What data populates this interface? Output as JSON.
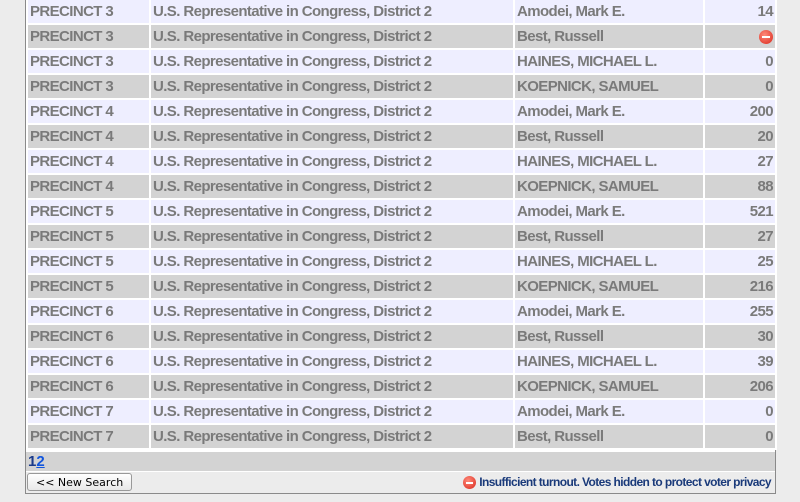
{
  "rows": [
    {
      "precinct": "PRECINCT 3",
      "contest": "U.S. Representative in Congress, District 2",
      "candidate": "Amodei, Mark E.",
      "votes": "14"
    },
    {
      "precinct": "PRECINCT 3",
      "contest": "U.S. Representative in Congress, District 2",
      "candidate": "Best, Russell",
      "votes": null,
      "hidden": true
    },
    {
      "precinct": "PRECINCT 3",
      "contest": "U.S. Representative in Congress, District 2",
      "candidate": "HAINES, MICHAEL L.",
      "votes": "0"
    },
    {
      "precinct": "PRECINCT 3",
      "contest": "U.S. Representative in Congress, District 2",
      "candidate": "KOEPNICK, SAMUEL",
      "votes": "0"
    },
    {
      "precinct": "PRECINCT 4",
      "contest": "U.S. Representative in Congress, District 2",
      "candidate": "Amodei, Mark E.",
      "votes": "200"
    },
    {
      "precinct": "PRECINCT 4",
      "contest": "U.S. Representative in Congress, District 2",
      "candidate": "Best, Russell",
      "votes": "20"
    },
    {
      "precinct": "PRECINCT 4",
      "contest": "U.S. Representative in Congress, District 2",
      "candidate": "HAINES, MICHAEL L.",
      "votes": "27"
    },
    {
      "precinct": "PRECINCT 4",
      "contest": "U.S. Representative in Congress, District 2",
      "candidate": "KOEPNICK, SAMUEL",
      "votes": "88"
    },
    {
      "precinct": "PRECINCT 5",
      "contest": "U.S. Representative in Congress, District 2",
      "candidate": "Amodei, Mark E.",
      "votes": "521"
    },
    {
      "precinct": "PRECINCT 5",
      "contest": "U.S. Representative in Congress, District 2",
      "candidate": "Best, Russell",
      "votes": "27"
    },
    {
      "precinct": "PRECINCT 5",
      "contest": "U.S. Representative in Congress, District 2",
      "candidate": "HAINES, MICHAEL L.",
      "votes": "25"
    },
    {
      "precinct": "PRECINCT 5",
      "contest": "U.S. Representative in Congress, District 2",
      "candidate": "KOEPNICK, SAMUEL",
      "votes": "216"
    },
    {
      "precinct": "PRECINCT 6",
      "contest": "U.S. Representative in Congress, District 2",
      "candidate": "Amodei, Mark E.",
      "votes": "255"
    },
    {
      "precinct": "PRECINCT 6",
      "contest": "U.S. Representative in Congress, District 2",
      "candidate": "Best, Russell",
      "votes": "30"
    },
    {
      "precinct": "PRECINCT 6",
      "contest": "U.S. Representative in Congress, District 2",
      "candidate": "HAINES, MICHAEL L.",
      "votes": "39"
    },
    {
      "precinct": "PRECINCT 6",
      "contest": "U.S. Representative in Congress, District 2",
      "candidate": "KOEPNICK, SAMUEL",
      "votes": "206"
    },
    {
      "precinct": "PRECINCT 7",
      "contest": "U.S. Representative in Congress, District 2",
      "candidate": "Amodei, Mark E.",
      "votes": "0"
    },
    {
      "precinct": "PRECINCT 7",
      "contest": "U.S. Representative in Congress, District 2",
      "candidate": "Best, Russell",
      "votes": "0"
    }
  ],
  "pagination": {
    "current": "1",
    "pages": [
      "2"
    ]
  },
  "footer": {
    "new_search_label": "<< New Search",
    "notice": "Insufficient turnout. Votes hidden to protect voter privacy",
    "notice_icon": "no-entry-icon"
  },
  "colors": {
    "row_odd": "#eeeeff",
    "row_even": "#d3d3d3",
    "hidden_icon": "#d9281c",
    "link": "#1155dd"
  }
}
